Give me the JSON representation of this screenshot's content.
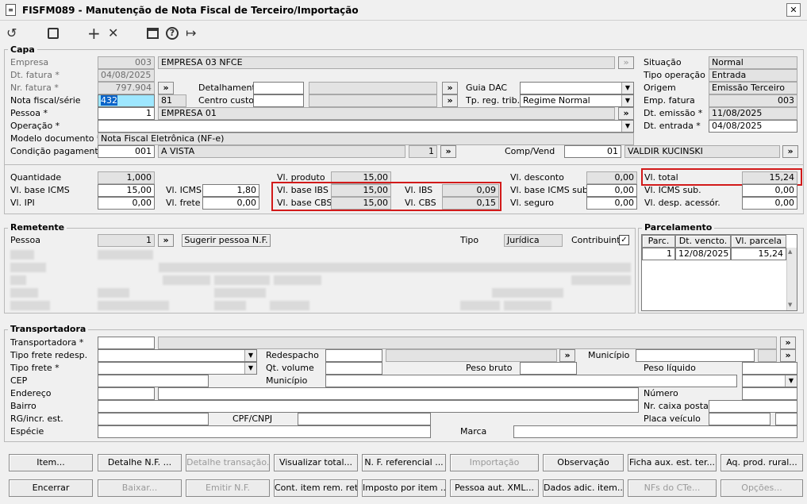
{
  "window": {
    "title": "FISFM089 - Manutenção de Nota Fiscal de Terceiro/Importação",
    "close": "✕"
  },
  "toolbar": {
    "undo": "↺",
    "save": "💾",
    "add": "+",
    "remove": "✕",
    "calendar": "📅",
    "help": "?",
    "exit": "↦"
  },
  "capa": {
    "title": "Capa",
    "empresa_label": "Empresa",
    "empresa_code": "003",
    "empresa_name": "EMPRESA 03 NFCE",
    "dt_fatura_label": "Dt. fatura *",
    "dt_fatura": "04/08/2025",
    "nr_fatura_label": "Nr. fatura *",
    "nr_fatura": "797.904",
    "nota_label": "Nota fiscal/série",
    "nota": "432",
    "serie": "81",
    "pessoa_label": "Pessoa *",
    "pessoa_code": "1",
    "pessoa_name": "EMPRESA 01",
    "operacao_label": "Operação *",
    "modelo_label": "Modelo documento *",
    "modelo": "Nota Fiscal Eletrônica (NF-e)",
    "condicao_label": "Condição pagamento*",
    "condicao_code": "001",
    "condicao_name": "A VISTA",
    "condicao_parc": "1",
    "detalhamento_label": "Detalhamento",
    "centro_label": "Centro custo",
    "guia_label": "Guia DAC",
    "tpreg_label": "Tp. reg. trib.",
    "tpreg": "Regime Normal",
    "comp_label": "Comp/Vend",
    "comp_code": "01",
    "comp_name": "VALDIR KUCINSKI",
    "situacao_label": "Situação",
    "situacao": "Normal",
    "tipo_op_label": "Tipo operação",
    "tipo_op": "Entrada",
    "origem_label": "Origem",
    "origem": "Emissão Terceiro",
    "emp_fatura_label": "Emp. fatura",
    "emp_fatura": "003",
    "dt_emissao_label": "Dt. emissão *",
    "dt_emissao": "11/08/2025",
    "dt_entrada_label": "Dt. entrada *",
    "dt_entrada": "04/08/2025"
  },
  "valores": {
    "quantidade_label": "Quantidade",
    "quantidade": "1,000",
    "base_icms_label": "Vl. base ICMS",
    "base_icms": "15,00",
    "ipi_label": "Vl. IPI",
    "ipi": "0,00",
    "icms_label": "Vl. ICMS",
    "icms": "1,80",
    "frete_label": "Vl. frete",
    "frete": "0,00",
    "produto_label": "Vl. produto",
    "produto": "15,00",
    "base_ibs_label": "Vl. base IBS",
    "base_ibs": "15,00",
    "base_cbs_label": "Vl. base CBS",
    "base_cbs": "15,00",
    "ibs_label": "Vl. IBS",
    "ibs": "0,09",
    "cbs_label": "Vl. CBS",
    "cbs": "0,15",
    "desconto_label": "Vl. desconto",
    "desconto": "0,00",
    "base_icms_sub_label": "Vl. base ICMS sub.",
    "base_icms_sub": "0,00",
    "seguro_label": "Vl. seguro",
    "seguro": "0,00",
    "total_label": "Vl. total",
    "total": "15,24",
    "icms_sub_label": "Vl. ICMS sub.",
    "icms_sub": "0,00",
    "desp_label": "Vl. desp. acessór.",
    "desp": "0,00"
  },
  "remetente": {
    "title": "Remetente",
    "pessoa_label": "Pessoa",
    "pessoa": "1",
    "sugerir": "Sugerir pessoa N.F.",
    "tipo_label": "Tipo",
    "tipo": "Jurídica",
    "contribuinte_label": "Contribuinte",
    "contribuinte_check": "✓"
  },
  "parcelamento": {
    "title": "Parcelamento",
    "cols": [
      "Parc.",
      "Dt. vencto.",
      "Vl. parcela"
    ],
    "rows": [
      [
        "1",
        "12/08/2025",
        "15,24"
      ]
    ]
  },
  "transportadora": {
    "title": "Transportadora",
    "transp_label": "Transportadora *",
    "tipo_frete_redesp_label": "Tipo frete redesp.",
    "tipo_frete_label": "Tipo frete *",
    "cep_label": "CEP",
    "endereco_label": "Endereço",
    "bairro_label": "Bairro",
    "rg_label": "RG/incr. est.",
    "especie_label": "Espécie",
    "redespacho_label": "Redespacho",
    "qt_volume_label": "Qt. volume",
    "municipio_label": "Município",
    "municipio2_label": "Município",
    "peso_bruto_label": "Peso bruto",
    "peso_liquido_label": "Peso líquido",
    "cpf_label": "CPF/CNPJ",
    "numero_label": "Número",
    "caixa_label": "Nr. caixa postal",
    "placa_label": "Placa veículo",
    "marca_label": "Marca"
  },
  "buttons_row1": [
    "Item...",
    "Detalhe N.F. ...",
    "Detalhe transação...",
    "Visualizar total...",
    "N. F. referencial ...",
    "Importação",
    "Observação",
    "Ficha aux. est. ter...",
    "Aq. prod. rural..."
  ],
  "buttons_row2": [
    "Encerrar",
    "Baixar...",
    "Emitir N.F.",
    "Cont. item rem. ret...",
    "Imposto por item ...",
    "Pessoa aut. XML...",
    "Dados adic. item...",
    "NFs do CTe...",
    "Opções..."
  ],
  "colors": {
    "highlight_red": "#d21a1a",
    "selected_field": "#9ee7ff"
  }
}
